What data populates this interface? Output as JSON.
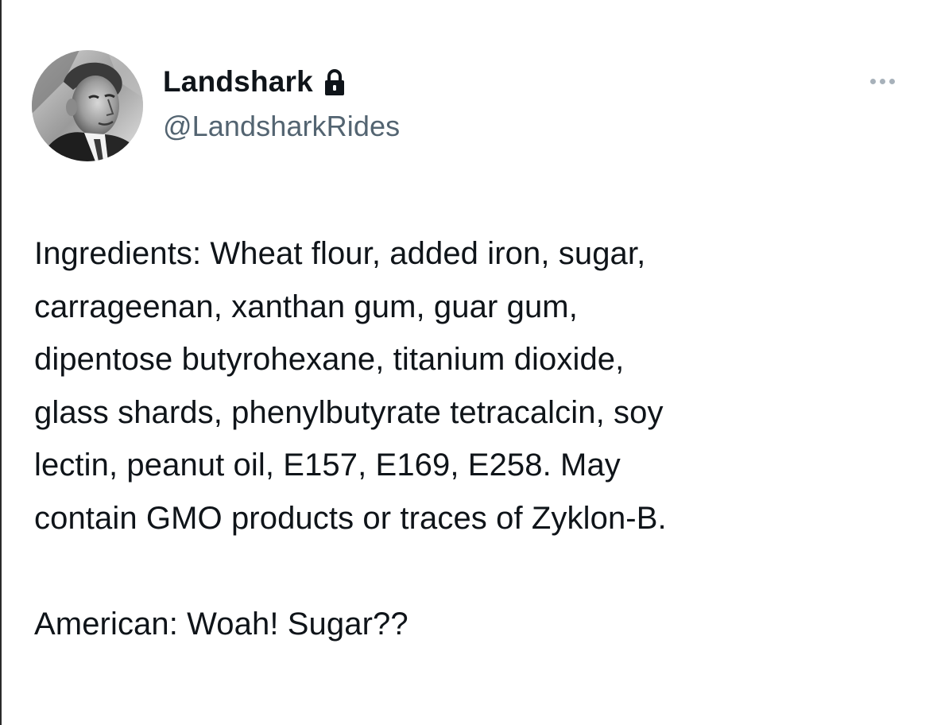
{
  "author": {
    "display_name": "Landshark",
    "handle": "@LandsharkRides",
    "protected": true,
    "avatar": "avatar-photo"
  },
  "icons": {
    "lock": "lock-icon",
    "more": "more-options-icon"
  },
  "tweet": {
    "lines": [
      "Ingredients: Wheat flour, added iron, sugar,",
      "carrageenan, xanthan gum, guar gum,",
      "dipentose butyrohexane, titanium dioxide,",
      "glass shards, phenylbutyrate tetracalcin, soy",
      "lectin, peanut oil, E157, E169, E258. May",
      "contain GMO products or traces of Zyklon-B."
    ],
    "reply_line": "American: Woah! Sugar??"
  },
  "colors": {
    "text": "#0f1419",
    "handle": "#536471",
    "more_dots": "#a7b1ba",
    "background": "#ffffff"
  }
}
